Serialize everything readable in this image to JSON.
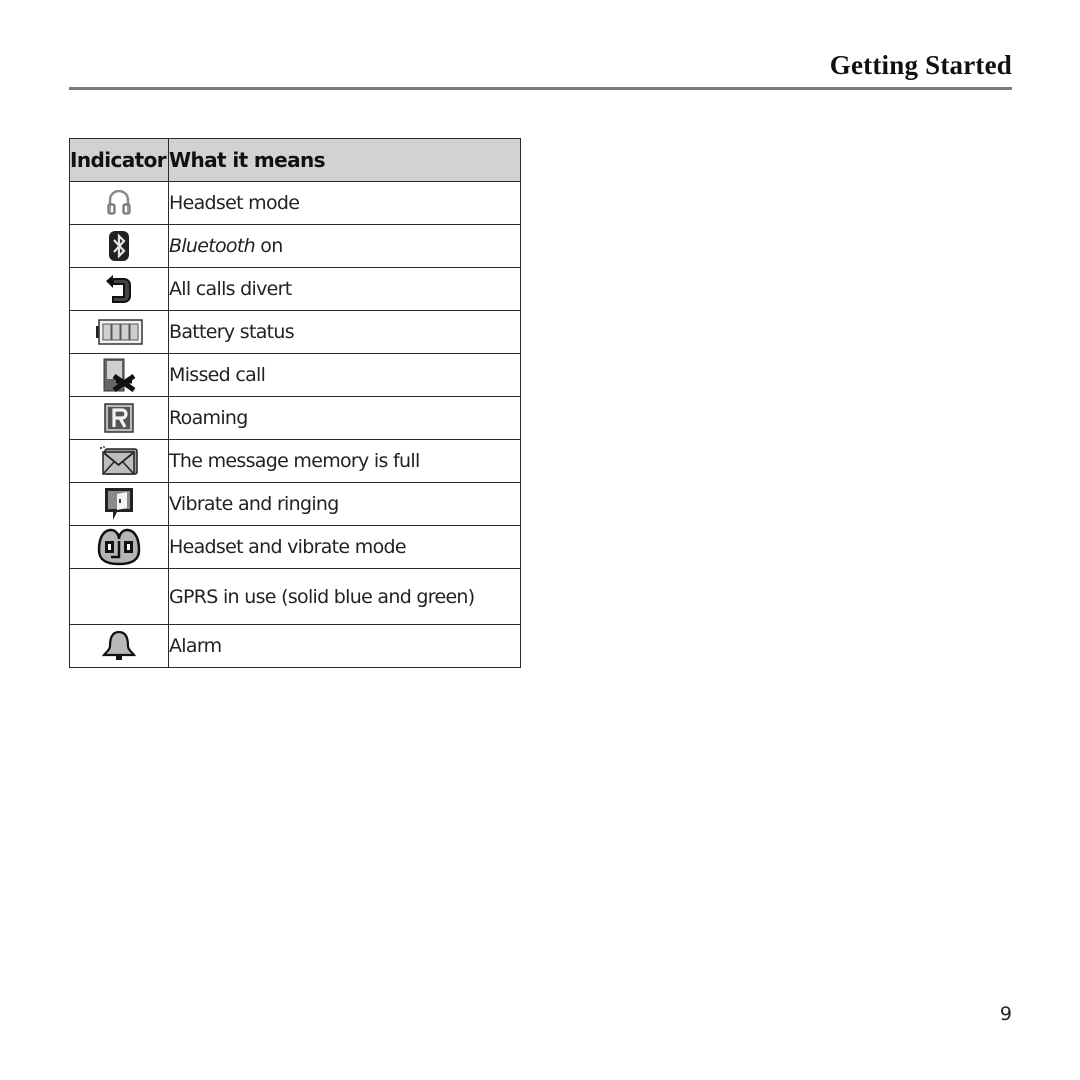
{
  "header": {
    "section_title": "Getting Started"
  },
  "table": {
    "columns": [
      "Indicator",
      "What it means"
    ],
    "rows": [
      {
        "icon": "headset-icon",
        "meaning": "Headset mode"
      },
      {
        "icon": "bluetooth-icon",
        "meaning_italic": "Bluetooth",
        "meaning_rest": " on"
      },
      {
        "icon": "call-divert-icon",
        "meaning": "All calls divert"
      },
      {
        "icon": "battery-icon",
        "meaning": "Battery status"
      },
      {
        "icon": "missed-call-icon",
        "meaning": "Missed call"
      },
      {
        "icon": "roaming-icon",
        "meaning": "Roaming"
      },
      {
        "icon": "message-full-icon",
        "meaning": "The message memory is full"
      },
      {
        "icon": "vibrate-ring-icon",
        "meaning": "Vibrate and ringing"
      },
      {
        "icon": "headset-vibrate-icon",
        "meaning": "Headset and vibrate mode"
      },
      {
        "icon": "",
        "meaning": "GPRS in use (solid blue and green)"
      },
      {
        "icon": "alarm-icon",
        "meaning": "Alarm"
      }
    ]
  },
  "footer": {
    "page_number": "9"
  }
}
